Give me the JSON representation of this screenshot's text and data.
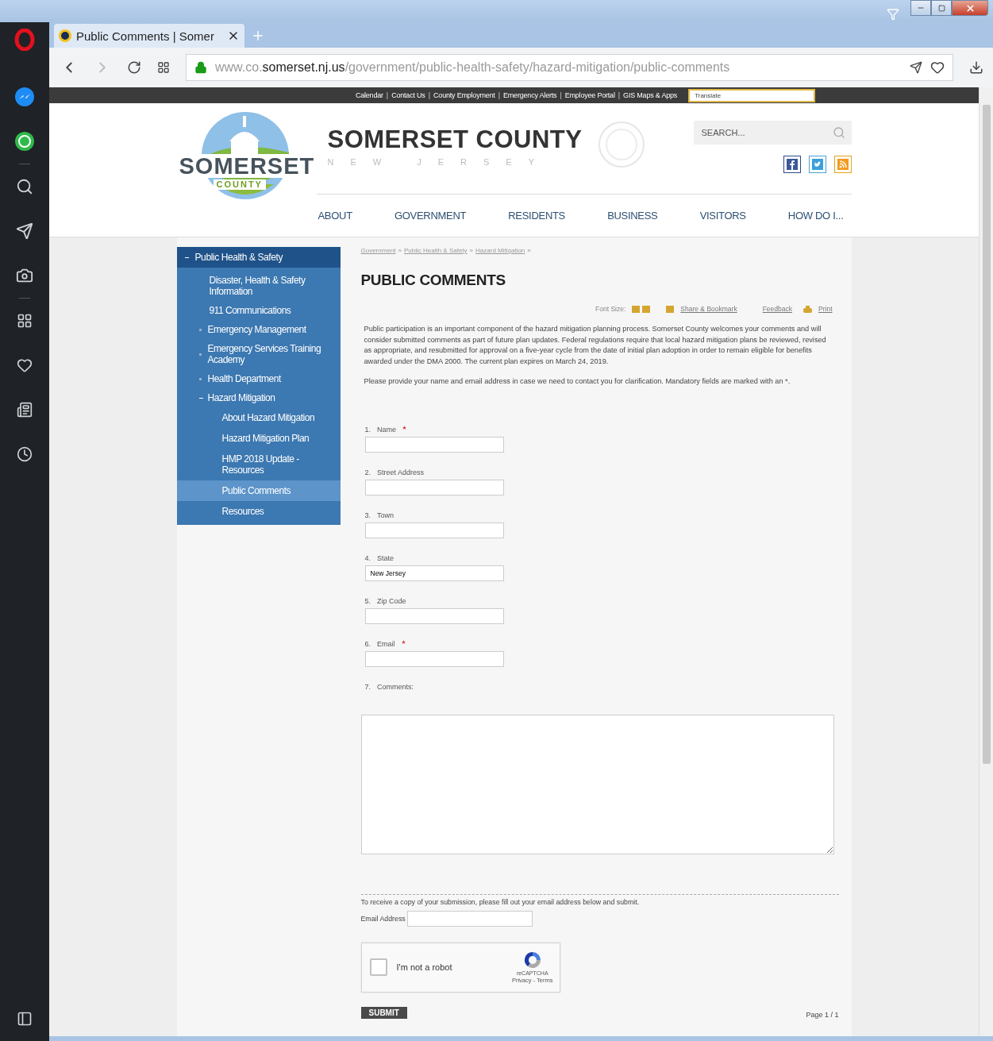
{
  "browser": {
    "tab_title": "Public Comments | Somer",
    "url": {
      "prefix": "www.co.",
      "domain": "somerset.nj.us",
      "path": "/government/public-health-safety/hazard-mitigation/public-comments"
    }
  },
  "utility_bar": {
    "links": [
      "Calendar",
      "Contact Us",
      "County Employment",
      "Emergency Alerts",
      "Employee Portal",
      "GIS Maps & Apps"
    ],
    "separator": "|",
    "translate": "Translate"
  },
  "header": {
    "logo": {
      "word": "SOMERSET",
      "sub": "COUNTY"
    },
    "title": "SOMERSET COUNTY",
    "subtitle": "NEW JERSEY",
    "search": {
      "placeholder": "SEARCH..."
    }
  },
  "nav": [
    "ABOUT",
    "GOVERNMENT",
    "RESIDENTS",
    "BUSINESS",
    "VISITORS",
    "HOW DO I..."
  ],
  "sidebar": {
    "heading": "Public Health & Safety",
    "expanded": true,
    "items": [
      {
        "label": "Disaster, Health & Safety Information",
        "kind": "leaf",
        "selected": false
      },
      {
        "label": "911 Communications",
        "kind": "leaf",
        "selected": false
      },
      {
        "label": "Emergency Management",
        "kind": "folder",
        "expanded": false,
        "selected": false
      },
      {
        "label": "Emergency Services Training Academy",
        "kind": "folder",
        "expanded": false,
        "selected": false
      },
      {
        "label": "Health Department",
        "kind": "folder",
        "expanded": false,
        "selected": false
      },
      {
        "label": "Hazard Mitigation",
        "kind": "folder",
        "expanded": true,
        "selected": false,
        "children": [
          {
            "label": "About Hazard Mitigation",
            "selected": false
          },
          {
            "label": "Hazard Mitigation Plan",
            "selected": false
          },
          {
            "label": "HMP 2018 Update - Resources",
            "selected": false
          },
          {
            "label": "Public Comments",
            "selected": true
          },
          {
            "label": "Resources",
            "selected": false
          }
        ]
      }
    ]
  },
  "breadcrumb": {
    "items": [
      "Government",
      "Public Health & Safety",
      "Hazard Mitigation"
    ],
    "separator": "»"
  },
  "page_title": "PUBLIC COMMENTS",
  "tools": {
    "font_size": "Font Size:",
    "share": "Share & Bookmark",
    "feedback": "Feedback",
    "print": "Print"
  },
  "paragraphs": [
    "Public participation is an important component of the hazard mitigation planning process.  Somerset County welcomes your comments and will consider submitted comments as part of future plan updates.  Federal regulations require that local hazard mitigation plans be reviewed, revised as appropriate, and resubmitted for approval on a five-year cycle from the date of initial plan adoption in order to remain eligible for benefits awarded under the DMA 2000.  The current plan expires on March 24, 2019.",
    "Please provide your name and email address in case we need to contact you for clarification.  Mandatory fields are marked with an *."
  ],
  "form": {
    "fields": [
      {
        "number": "1.",
        "label": "Name",
        "required": true,
        "kind": "text"
      },
      {
        "number": "2.",
        "label": "Street Address",
        "required": false,
        "kind": "text"
      },
      {
        "number": "3.",
        "label": "Town",
        "required": false,
        "kind": "text"
      },
      {
        "number": "4.",
        "label": "State",
        "required": false,
        "kind": "text",
        "value": "New Jersey"
      },
      {
        "number": "5.",
        "label": "Zip Code",
        "required": false,
        "kind": "text"
      },
      {
        "number": "6.",
        "label": "Email",
        "required": true,
        "kind": "text"
      },
      {
        "number": "7.",
        "label": "Comments:",
        "required": false,
        "kind": "textarea"
      }
    ],
    "copy_note": "To receive a copy of your submission, please fill out your email address below and submit.",
    "email_label": "Email Address",
    "captcha": {
      "label": "I'm not a robot",
      "checked": false,
      "brand": "reCAPTCHA",
      "links": "Privacy - Terms"
    },
    "submit": "SUBMIT",
    "page": "Page 1 / 1"
  }
}
